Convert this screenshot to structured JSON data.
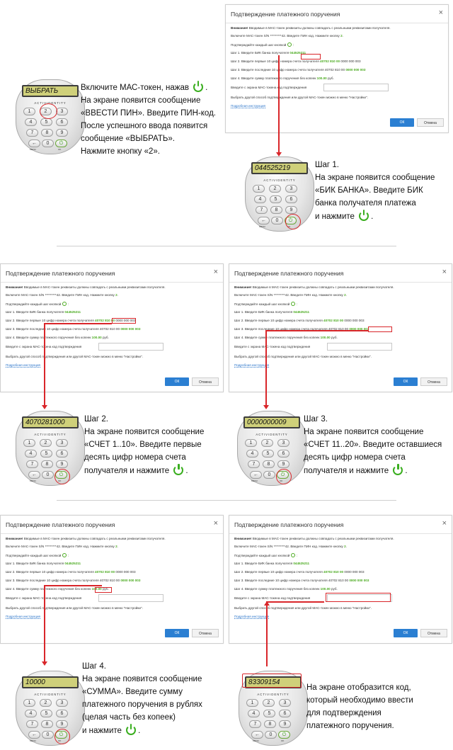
{
  "dialog": {
    "title": "Подтверждение платежного поручения",
    "close": "×",
    "warning_label": "Внимание!",
    "warning_text": " Вводимые в МАС-токен реквизиты должны совпадать с реальными реквизитами получателя.",
    "token_line": "Включите МАС-токен S/N *********42. Введите ПИН код. Нажмите кнопку",
    "token_key": "2",
    "confirm_line": "Подтверждайте каждый шаг кнопкой",
    "step1_text": "Шаг 1. Введите БИК банка получателя",
    "step1_value": "044525211",
    "step2_text": "Шаг 2. Введите первые 10 цифр номера счета получателя",
    "step2_value": "40702 810 00",
    "step2_rest": "0000 000 003",
    "step3_text": "Шаг 3. Введите последние 10 цифр номера счета получателя 40702 810 00",
    "step3_value": "0000 000 003",
    "step4_text": "Шаг 4. Введите сумму платежного поручения без копеек",
    "step4_value": "100.00",
    "step4_unit": " руб.",
    "code_label": "Введите с экрана МАС-токена код подтверждения",
    "alt_line": "Выбрать другой способ подтверждения или другой МАС-токен можно в меню \"Настройки\".",
    "details_link": "Подробная инструкция",
    "ok": "ОК",
    "cancel": "Отмена"
  },
  "token": {
    "brand": "ACTIVIDENTITY",
    "keys": [
      "1",
      "2",
      "3",
      "4",
      "5",
      "6",
      "7",
      "8",
      "9",
      "←",
      "0"
    ],
    "menu_label": "MENU",
    "ok_label": "OK"
  },
  "intro": {
    "screen": "ВЫБРАТЬ",
    "lines": [
      "Включите МАС-токен, нажав",
      "На экране появится сообщение",
      "«ВВЕСТИ ПИН». Введите ПИН-код.",
      "После успешного ввода появится",
      "сообщение «ВЫБРАТЬ».",
      "Нажмите кнопку «2»."
    ]
  },
  "step1": {
    "screen": "044525219",
    "lines": [
      "Шаг 1.",
      "На экране появится сообщение",
      "«БИК БАНКА». Введите БИК",
      "банка получателя платежа",
      "и нажмите"
    ]
  },
  "step2": {
    "screen": "4070281000",
    "lines": [
      "Шаг 2.",
      "На экране появится сообщение",
      "«СЧЕТ 1..10». Введите первые",
      "десять цифр номера счета",
      "получателя и нажмите"
    ]
  },
  "step3": {
    "screen": "0000000009",
    "lines": [
      "Шаг 3.",
      "На экране появится сообщение",
      "«СЧЕТ 11..20». Введите оставшиеся",
      "десять цифр номера счета",
      "получателя и нажмите"
    ]
  },
  "step4": {
    "screen": "10000",
    "lines": [
      "Шаг 4.",
      "На экране появится сообщение",
      "«СУММА». Введите сумму",
      "платежного поручения в рублях",
      "(целая часть без копеек)",
      "и нажмите"
    ]
  },
  "final": {
    "screen": "83309154",
    "lines": [
      "На экране отобразится код,",
      "который необходимо ввести",
      "для подтверждения",
      "платежного поручения."
    ]
  },
  "colors": {
    "accent_green": "#3aae1f",
    "highlight_red": "#d9262a",
    "button_blue": "#2b7fd2",
    "lcd": "#cfd07a"
  }
}
